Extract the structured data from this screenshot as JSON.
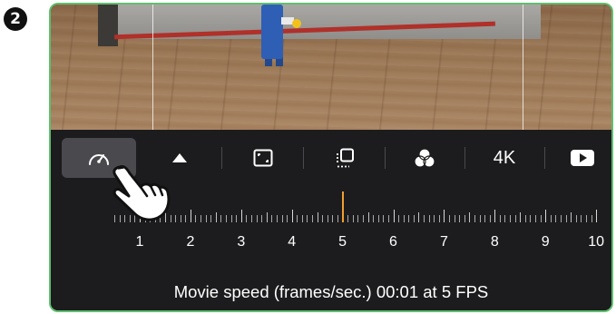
{
  "step_badge": "2",
  "toolbar": {
    "speed_icon": "speedometer-icon",
    "triangle_icon": "triangle-up-icon",
    "fullscreen_icon": "frame-corners-icon",
    "overlay_icon": "onion-skin-icon",
    "color_icon": "color-filter-icon",
    "resolution_label": "4K",
    "play_icon": "play-icon"
  },
  "timeline": {
    "labels": [
      "1",
      "2",
      "3",
      "4",
      "5",
      "6",
      "7",
      "8",
      "9",
      "10"
    ],
    "playhead_value": 5
  },
  "caption": "Movie speed (frames/sec.) 00:01 at 5 FPS",
  "hand_icon": "pointing-hand-icon",
  "colors": {
    "frame_border": "#5fbf6f",
    "panel_bg": "#1c1c1e",
    "active_tool_bg": "#4a4a4e",
    "playhead": "#f0a030"
  }
}
